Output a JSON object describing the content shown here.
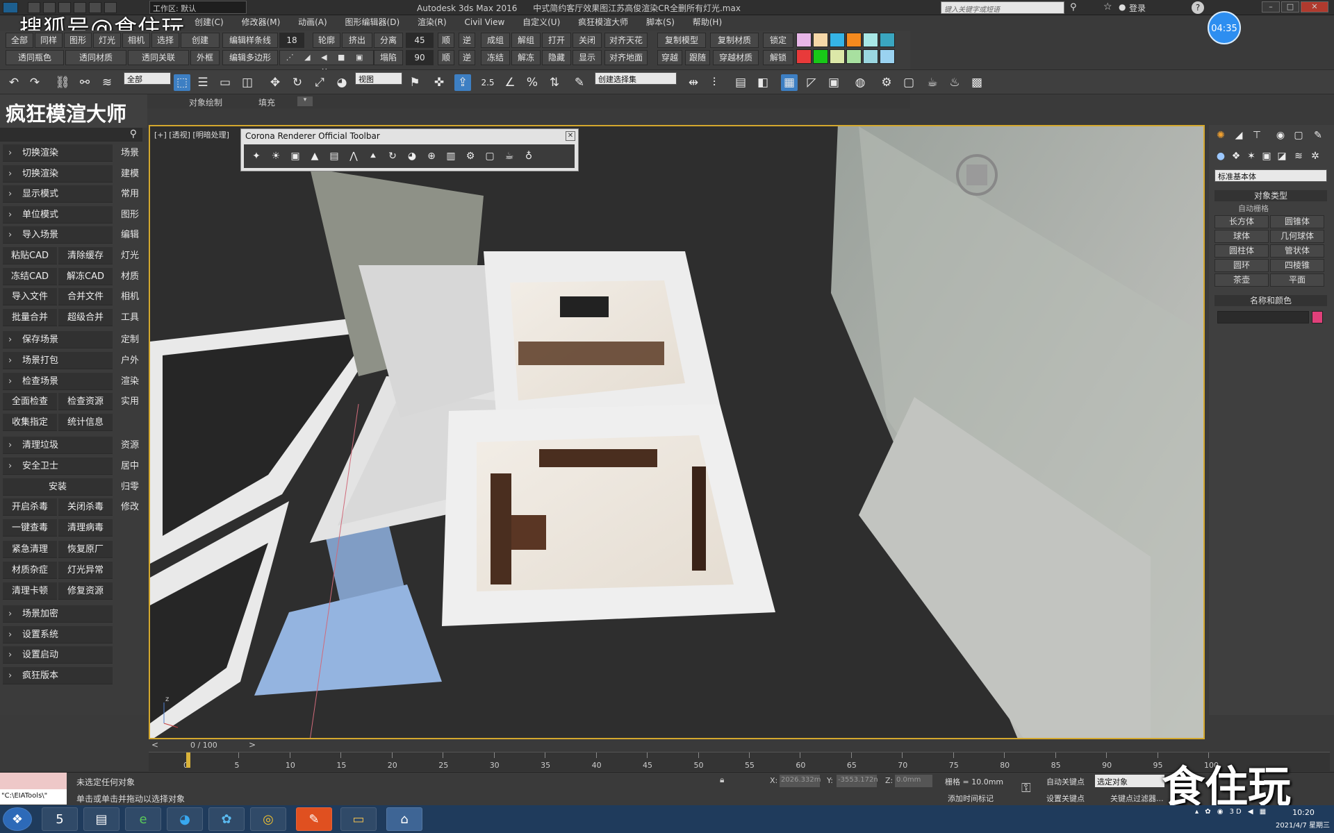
{
  "window": {
    "app_title": "Autodesk 3ds Max 2016",
    "file_title": "中式简约客厅效果图江苏高俊渲染CR全删所有灯光.max",
    "workspace": "工作区: 默认",
    "search_placeholder": "键入关键字或短语",
    "login": "登录",
    "clock_overlay": "04:35"
  },
  "watermark": {
    "top": "搜狐号@食住玩",
    "bottom": "食住玩"
  },
  "menubar": [
    "创建(C)",
    "修改器(M)",
    "动画(A)",
    "图形编辑器(D)",
    "渲染(R)",
    "Civil View",
    "自定义(U)",
    "疯狂模渲大师",
    "脚本(S)",
    "帮助(H)"
  ],
  "toolrow1": [
    "全部",
    "同样",
    "图形",
    "灯光",
    "相机",
    "选择",
    "创建",
    "编辑样条线",
    "轮廓",
    "挤出",
    "分离",
    "顺",
    "逆",
    "成组",
    "解组",
    "打开",
    "关闭",
    "对齐天花",
    "复制模型",
    "复制材质",
    "锁定"
  ],
  "toolrow2": [
    "透同瓶色",
    "透同材质",
    "透同关联",
    "外框",
    "编辑多边形",
    "塌陷",
    "顺",
    "逆",
    "冻结",
    "解冻",
    "隐藏",
    "显示",
    "对齐地面",
    "穿越",
    "跟随",
    "穿越材质",
    "解锁"
  ],
  "spinner_values": {
    "v1": "18",
    "v2": "45",
    "v3": "90"
  },
  "swatches_top": [
    "#e8b6e8",
    "#f6d8a8",
    "#35b4e6",
    "#f58a1e",
    "#a8e8e6",
    "#3aa6c0"
  ],
  "swatches_bottom": [
    "#e83a3a",
    "#18c818",
    "#dce8a8",
    "#a8e0a0",
    "#9ad6e0",
    "#9ad2f0"
  ],
  "main_toolbar": {
    "filter": "全部",
    "ref_coord": "视图",
    "selection_set": "创建选择集",
    "snap_label": "2.5"
  },
  "ribbon_tabs": [
    "对象绘制",
    "填充"
  ],
  "left_panel": {
    "brand": "疯狂模渲大师",
    "items": [
      {
        "label": "切换渲染",
        "chev": true,
        "cat": "场景"
      },
      {
        "label": "切换渲染",
        "chev": true,
        "cat": "建模"
      },
      {
        "label": "显示模式",
        "chev": true,
        "cat": "常用"
      },
      {
        "label": "单位模式",
        "chev": true,
        "cat": "图形"
      },
      {
        "label": "导入场景",
        "chev": true,
        "cat": "编辑"
      }
    ],
    "pairs1": [
      [
        "粘贴CAD",
        "清除缓存"
      ],
      [
        "冻结CAD",
        "解冻CAD"
      ],
      [
        "导入文件",
        "合并文件"
      ],
      [
        "批量合并",
        "超级合并"
      ]
    ],
    "cats1": [
      "灯光",
      "材质",
      "相机",
      "工具"
    ],
    "items2": [
      {
        "label": "保存场景",
        "cat": "定制"
      },
      {
        "label": "场景打包",
        "cat": "户外"
      },
      {
        "label": "检查场景",
        "cat": "渲染"
      }
    ],
    "pairs2": [
      [
        "全面检查",
        "检查资源"
      ],
      [
        "收集指定",
        "统计信息"
      ]
    ],
    "cats2": [
      "实用"
    ],
    "items3": [
      {
        "label": "清理垃圾",
        "cat": "资源"
      },
      {
        "label": "安全卫士",
        "cat": "居中"
      }
    ],
    "install": "安装",
    "cats3": [
      "归零",
      "修改"
    ],
    "pairs3": [
      [
        "开启杀毒",
        "关闭杀毒"
      ],
      [
        "一键查毒",
        "清理病毒"
      ],
      [
        "紧急清理",
        "恢复原厂"
      ],
      [
        "材质杂症",
        "灯光异常"
      ],
      [
        "清理卡顿",
        "修复资源"
      ]
    ],
    "items4": [
      "场景加密",
      "设置系统",
      "设置启动",
      "疯狂版本"
    ]
  },
  "viewport": {
    "label": "[+] [透视] [明暗处理]",
    "corona_title": "Corona Renderer Official Toolbar"
  },
  "right_panel": {
    "dropdown": "标准基本体",
    "object_type": "对象类型",
    "auto_grid": "自动栅格",
    "buttons": [
      "长方体",
      "圆锥体",
      "球体",
      "几何球体",
      "圆柱体",
      "管状体",
      "圆环",
      "四棱锥",
      "茶壶",
      "平面"
    ],
    "name_color": "名称和颜色",
    "object_color": "#e0407a"
  },
  "timeline": {
    "frame": "0 / 100",
    "ticks": [
      "0",
      "5",
      "10",
      "15",
      "20",
      "25",
      "30",
      "35",
      "40",
      "45",
      "50",
      "55",
      "60",
      "65",
      "70",
      "75",
      "80",
      "85",
      "90",
      "95",
      "100"
    ]
  },
  "status": {
    "script_path": "\"C:\\EIATools\\\"",
    "msg1": "未选定任何对象",
    "msg2": "单击或单击并拖动以选择对象",
    "x_value": "2026.332m",
    "y_value": "-3553.172n",
    "z_value": "0.0mm",
    "grid": "栅格 = 10.0mm",
    "add_time_tag": "添加时间标记",
    "auto_key": "自动关键点",
    "set_key": "设置关键点",
    "selected": "选定对象",
    "key_filter": "关键点过滤器..."
  },
  "taskbar": {
    "time": "10:20",
    "date": "2021/4/7 星期三"
  }
}
